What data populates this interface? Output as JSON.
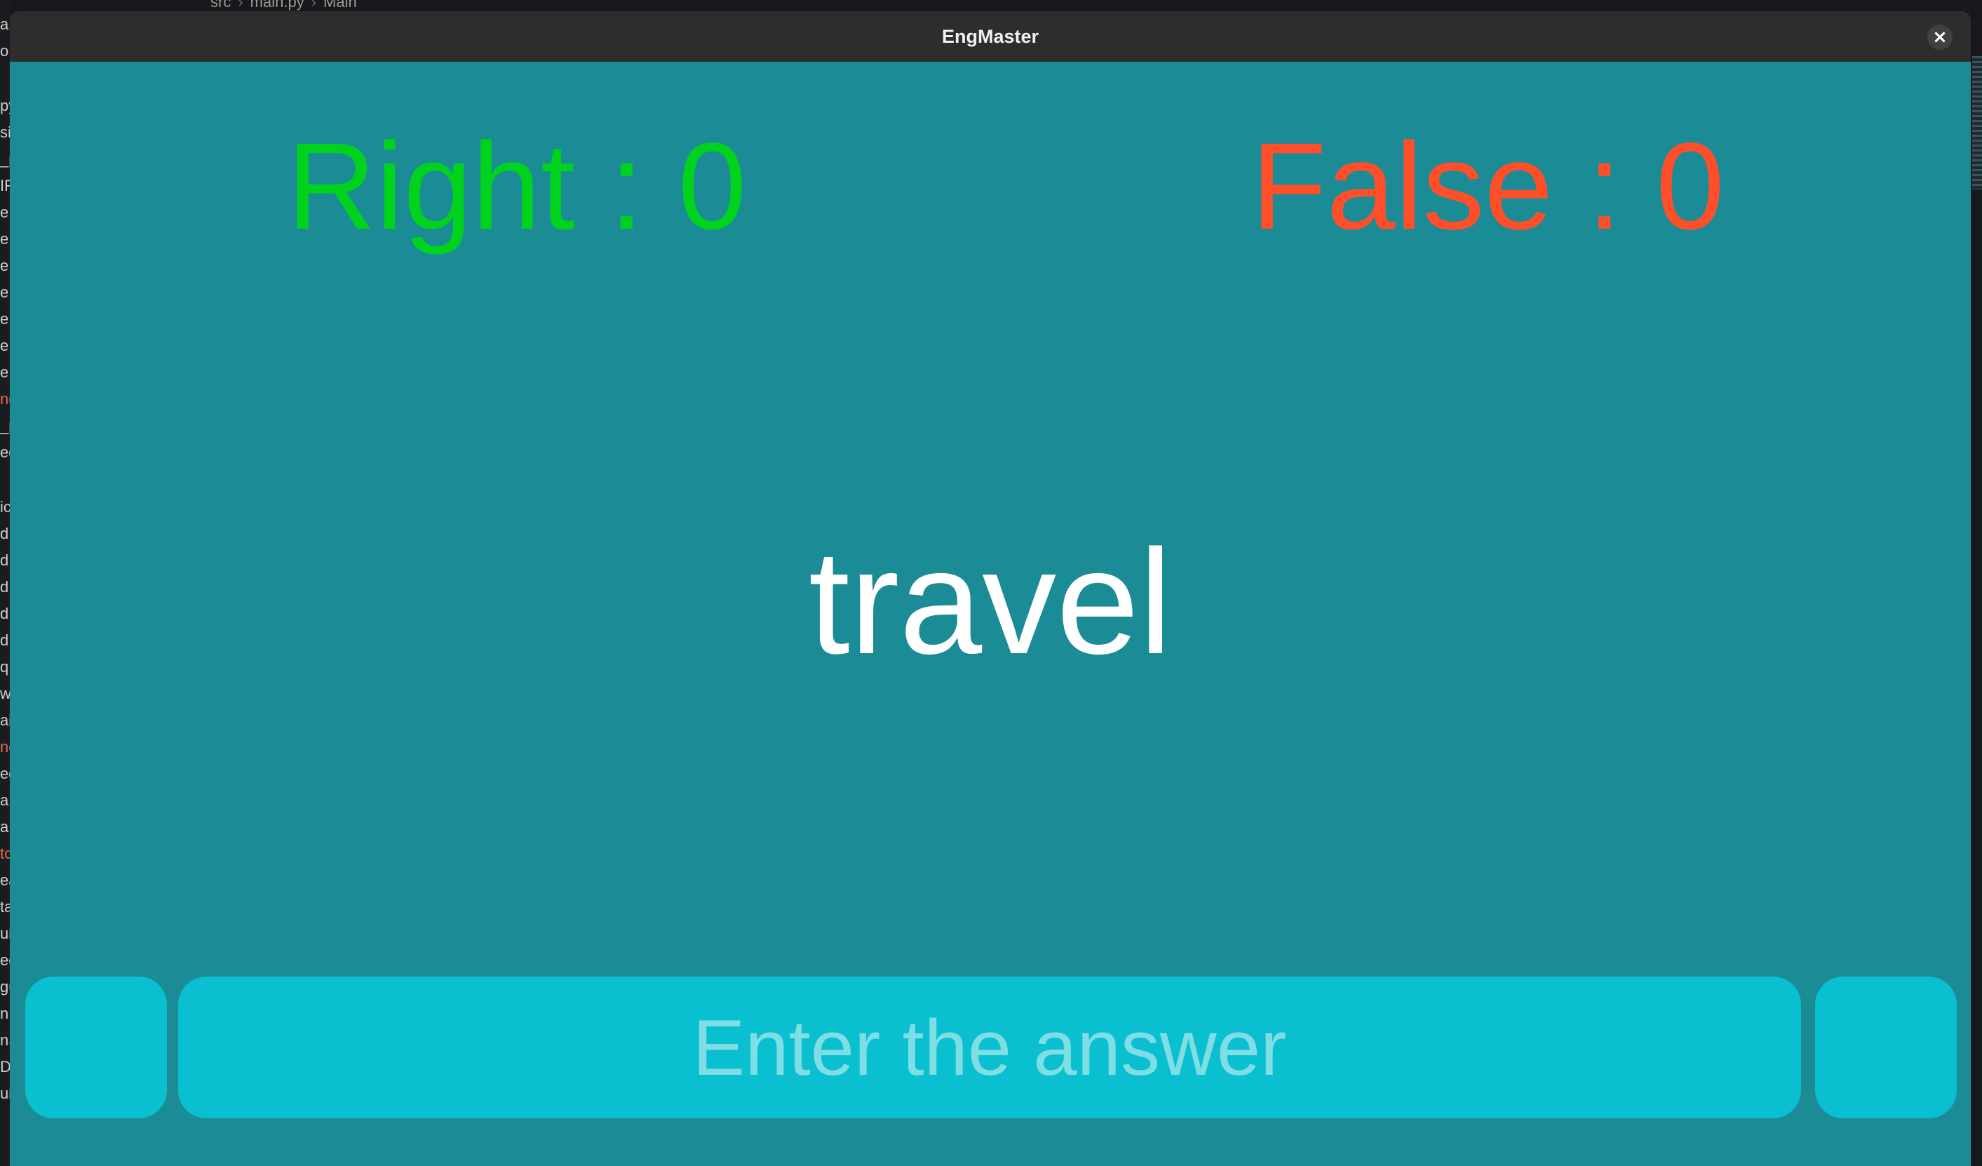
{
  "window": {
    "title": "EngMaster",
    "close_glyph": "×"
  },
  "scores": {
    "right_text": "Right : 0",
    "false_text": "False : 0",
    "right_color": "#00d21e",
    "false_color": "#ff4e2a"
  },
  "quiz": {
    "word": "travel"
  },
  "answer": {
    "placeholder": "Enter the answer",
    "value": ""
  },
  "background_editor": {
    "breadcrumb": [
      "src",
      "main.py",
      "Main"
    ],
    "sidebar_fragments": [
      "a",
      "o",
      "py",
      "si",
      "_p",
      "IF",
      "e",
      "e",
      "e",
      "e",
      "e",
      "e",
      "e",
      "nc",
      "_p",
      "eg",
      "ic",
      "d",
      "d",
      "d",
      "d",
      "d",
      "q",
      "w",
      "ai",
      "nc",
      "eg",
      "a",
      "a",
      "tc",
      "ea",
      "ta",
      "ui",
      "ee",
      "gu",
      "n.",
      "nS",
      "D",
      "ui"
    ]
  },
  "colors": {
    "content_bg": "#1b8c96",
    "button_bg": "#0abfcf",
    "titlebar_bg": "#2d2d2d"
  }
}
